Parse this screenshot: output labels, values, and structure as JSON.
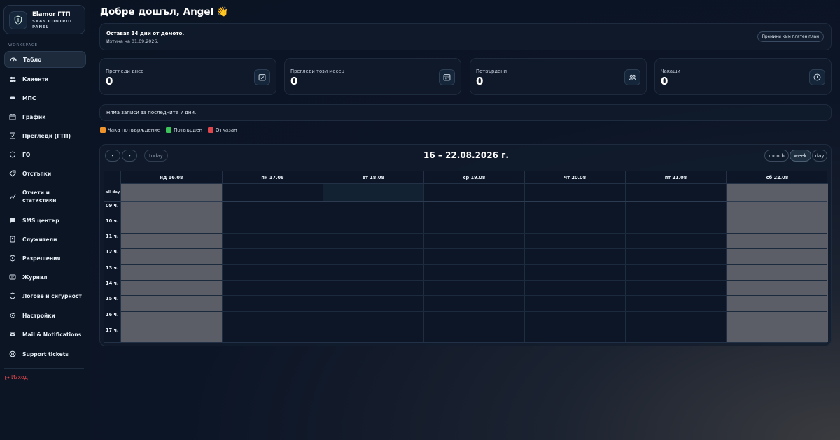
{
  "sidebar": {
    "brand_name": "Elamor ГТП",
    "brand_sub": "SAAS CONTROL PANEL",
    "section_label": "WORKSPACE",
    "items": [
      {
        "label": "Табло",
        "icon": "dashboard-icon"
      },
      {
        "label": "Клиенти",
        "icon": "users-icon"
      },
      {
        "label": "МПС",
        "icon": "car-icon"
      },
      {
        "label": "График",
        "icon": "calendar-icon"
      },
      {
        "label": "Прегледи (ГТП)",
        "icon": "inspection-icon"
      },
      {
        "label": "ГО",
        "icon": "shield-icon"
      },
      {
        "label": "Отстъпки",
        "icon": "discount-icon"
      },
      {
        "label": "Отчети и статистики",
        "icon": "chart-icon"
      },
      {
        "label": "SMS център",
        "icon": "chat-icon"
      },
      {
        "label": "Служители",
        "icon": "employee-icon"
      },
      {
        "label": "Разрешения",
        "icon": "permissions-icon"
      },
      {
        "label": "Журнал",
        "icon": "journal-icon"
      },
      {
        "label": "Логове и сигурност",
        "icon": "security-icon"
      },
      {
        "label": "Настройки",
        "icon": "gear-icon"
      },
      {
        "label": "Mail & Notifications",
        "icon": "mail-icon"
      },
      {
        "label": "Support tickets",
        "icon": "support-icon"
      }
    ],
    "logout_label": "Изход"
  },
  "header": {
    "greeting": "Добре дошъл, Angel 👋"
  },
  "demo": {
    "title": "Остават 14 дни от демото.",
    "expires": "Изтича на 01.09.2026.",
    "upgrade_label": "Премини към платен план"
  },
  "stats": [
    {
      "label": "Прегледи днес",
      "value": "0",
      "icon": "calendar-check-icon"
    },
    {
      "label": "Прегледи този месец",
      "value": "0",
      "icon": "calendar-month-icon"
    },
    {
      "label": "Потвърдени",
      "value": "0",
      "icon": "users-confirmed-icon"
    },
    {
      "label": "Чакащи",
      "value": "0",
      "icon": "clock-icon"
    }
  ],
  "no_records": "Няма записи за последните 7 дни.",
  "legend": [
    {
      "label": "Чака потвърждение",
      "color": "#f0932b"
    },
    {
      "label": "Потвърден",
      "color": "#3cc35a"
    },
    {
      "label": "Отказан",
      "color": "#e0474c"
    }
  ],
  "calendar": {
    "prev_label": "‹",
    "next_label": "›",
    "today_label": "today",
    "title": "16 – 22.08.2026 г.",
    "views": [
      "month",
      "week",
      "day"
    ],
    "active_view": "week",
    "allday_label": "all-day",
    "days": [
      "нд 16.08",
      "пн 17.08",
      "вт 18.08",
      "ср 19.08",
      "чт 20.08",
      "пт 21.08",
      "сб 22.08"
    ],
    "hours": [
      "09 ч.",
      "10 ч.",
      "11 ч.",
      "12 ч.",
      "13 ч.",
      "14 ч.",
      "15 ч.",
      "16 ч.",
      "17 ч."
    ]
  },
  "colors": {
    "accent": "#2a3a50",
    "weekend_shade": "#5b5e66",
    "logout": "#e0474c"
  }
}
